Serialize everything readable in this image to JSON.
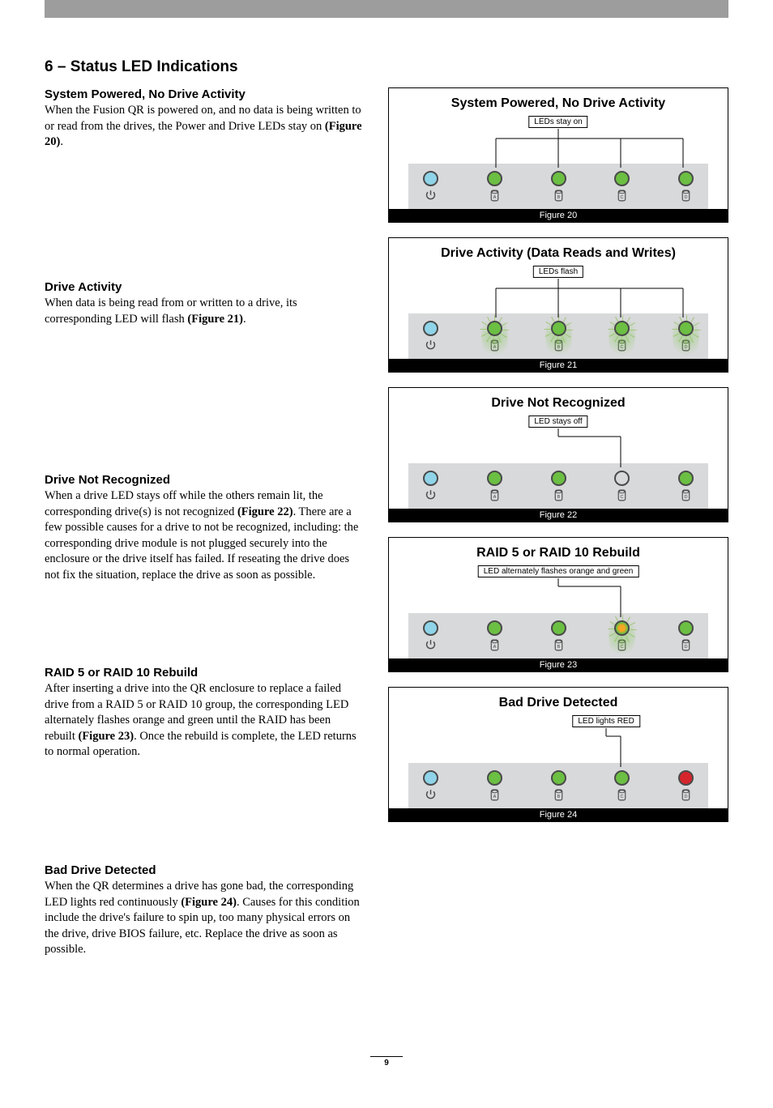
{
  "page_title": "6 – Status LED Indications",
  "page_number": "9",
  "sections": [
    {
      "heading": "System Powered, No Drive Activity",
      "body": "When the Fusion QR is powered on, and no data is being written to or read from the drives, the Power and Drive LEDs stay on ",
      "figref": "(Figure 20)",
      "tail": "."
    },
    {
      "heading": "Drive Activity",
      "body": "When data is being read from or written to a drive, its corresponding LED will flash ",
      "figref": "(Figure 21)",
      "tail": "."
    },
    {
      "heading": "Drive Not Recognized",
      "body": "When a drive LED stays off while the others remain lit, the corresponding drive(s) is not recognized ",
      "figref": "(Figure 22)",
      "tail": ". There are a few possible causes for a drive to not be recognized, including: the corresponding drive module is not plugged securely into the enclosure or the drive itself has failed. If reseating the drive does not fix the situation, replace the drive as soon as possible."
    },
    {
      "heading": "RAID 5 or RAID 10 Rebuild",
      "body": "After inserting a drive into the QR enclosure to replace a failed drive from a RAID 5 or RAID 10 group, the corresponding LED alternately flashes orange and green until the RAID has been rebuilt ",
      "figref": "(Figure 23)",
      "tail": ". Once the rebuild is complete, the LED returns to normal operation."
    },
    {
      "heading": "Bad Drive Detected",
      "body": "When the QR determines a drive has gone bad, the corresponding LED lights red continuously ",
      "figref": "(Figure 24)",
      "tail": ". Causes for this condition include the drive's failure to spin up, too many physical errors on the drive, drive BIOS failure, etc. Replace the drive as soon as possible."
    }
  ],
  "figures": [
    {
      "title": "System Powered, No Drive Activity",
      "callout": "LEDs stay on",
      "caption": "Figure 20",
      "branch": "all",
      "leds": [
        {
          "id": "power",
          "color": "blue",
          "icon": "power"
        },
        {
          "id": "A",
          "color": "green",
          "icon": "drive"
        },
        {
          "id": "B",
          "color": "green",
          "icon": "drive"
        },
        {
          "id": "C",
          "color": "green",
          "icon": "drive"
        },
        {
          "id": "D",
          "color": "green",
          "icon": "drive"
        }
      ]
    },
    {
      "title": "Drive Activity (Data Reads and Writes)",
      "callout": "LEDs flash",
      "caption": "Figure 21",
      "branch": "all",
      "leds": [
        {
          "id": "power",
          "color": "blue",
          "icon": "power"
        },
        {
          "id": "A",
          "color": "green",
          "icon": "drive",
          "flash": true
        },
        {
          "id": "B",
          "color": "green",
          "icon": "drive",
          "flash": true
        },
        {
          "id": "C",
          "color": "green",
          "icon": "drive",
          "flash": true
        },
        {
          "id": "D",
          "color": "green",
          "icon": "drive",
          "flash": true
        }
      ]
    },
    {
      "title": "Drive Not Recognized",
      "callout": "LED stays off",
      "caption": "Figure 22",
      "branch": "single-c",
      "leds": [
        {
          "id": "power",
          "color": "blue",
          "icon": "power"
        },
        {
          "id": "A",
          "color": "green",
          "icon": "drive"
        },
        {
          "id": "B",
          "color": "green",
          "icon": "drive"
        },
        {
          "id": "C",
          "color": "off",
          "icon": "drive"
        },
        {
          "id": "D",
          "color": "green",
          "icon": "drive"
        }
      ]
    },
    {
      "title": "RAID 5 or RAID 10 Rebuild",
      "callout": "LED alternately flashes orange and green",
      "caption": "Figure 23",
      "branch": "single-c",
      "leds": [
        {
          "id": "power",
          "color": "blue",
          "icon": "power"
        },
        {
          "id": "A",
          "color": "green",
          "icon": "drive"
        },
        {
          "id": "B",
          "color": "green",
          "icon": "drive"
        },
        {
          "id": "C",
          "color": "orange",
          "icon": "drive",
          "flash": true
        },
        {
          "id": "D",
          "color": "green",
          "icon": "drive"
        }
      ]
    },
    {
      "title": "Bad Drive Detected",
      "callout": "LED lights RED",
      "caption": "Figure 24",
      "branch": "single-d-shift",
      "leds": [
        {
          "id": "power",
          "color": "blue",
          "icon": "power"
        },
        {
          "id": "A",
          "color": "green",
          "icon": "drive"
        },
        {
          "id": "B",
          "color": "green",
          "icon": "drive"
        },
        {
          "id": "C",
          "color": "green",
          "icon": "drive"
        },
        {
          "id": "D",
          "color": "red",
          "icon": "drive"
        }
      ]
    }
  ]
}
